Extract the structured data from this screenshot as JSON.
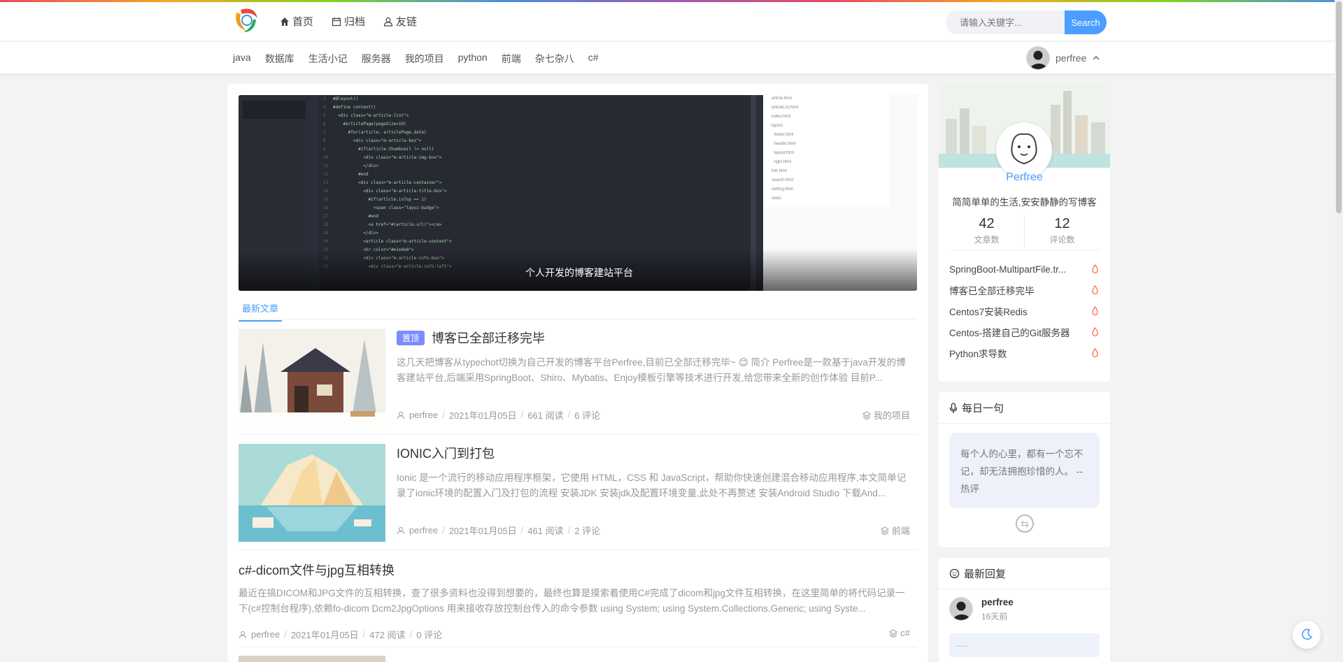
{
  "nav": {
    "items": [
      {
        "label": "首页",
        "icon": "home-icon"
      },
      {
        "label": "归档",
        "icon": "calendar-icon"
      },
      {
        "label": "友链",
        "icon": "user-icon"
      }
    ]
  },
  "search": {
    "placeholder": "请输入关键字...",
    "button": "Search"
  },
  "categories": [
    "java",
    "数据库",
    "生活小记",
    "服务器",
    "我的项目",
    "python",
    "前端",
    "杂七杂八",
    "c#"
  ],
  "user": {
    "name": "perfree"
  },
  "banner": {
    "caption": "个人开发的博客建站平台"
  },
  "tabs": {
    "latest": "最新文章"
  },
  "articles": [
    {
      "top_tag": "置顶",
      "title": "博客已全部迁移完毕",
      "summary": "这几天把博客从typechot切换为自己开发的博客平台Perfree,目前已全部迁移完毕~ 😊 简介 Perfree是一款基于java开发的博客建站平台,后端采用SpringBoot、Shiro、Mybatis、Enjoy模板引擎等技术进行开发,给您带来全新的创作体验 目前P...",
      "author": "perfree",
      "date": "2021年01月05日",
      "views": "661 阅读",
      "comments": "6 评论",
      "category": "我的项目"
    },
    {
      "title": "IONIC入门到打包",
      "summary": "Ionic 是一个流行的移动应用程序框架，它使用 HTML，CSS 和 JavaScript，帮助你快速创建混合移动应用程序,本文简单记录了ionic环境的配置入门及打包的流程 安装JDK 安装jdk及配置环境变量,此处不再赘述 安装Android Studio 下载And...",
      "author": "perfree",
      "date": "2021年01月05日",
      "views": "461 阅读",
      "comments": "2 评论",
      "category": "前端"
    },
    {
      "title": "c#-dicom文件与jpg互相转换",
      "summary": "最近在搞DICOM和JPG文件的互相转换，查了很多资料也没得到想要的，最终也算是摸索着使用C#完成了dicom和jpg文件互相转换，在这里简单的将代码记录一下(c#控制台程序),依赖fo-dicom Dcm2JpgOptions 用来接收存放控制台传入的命令参数 using System; using System.Collections.Generic; using Syste...",
      "author": "perfree",
      "date": "2021年01月05日",
      "views": "472 阅读",
      "comments": "0 评论",
      "category": "c#"
    }
  ],
  "profile": {
    "name": "Perfree",
    "motto": "简简单单的生活,安安静静的写博客",
    "articles_count": "42",
    "articles_label": "文章数",
    "comments_count": "12",
    "comments_label": "评论数",
    "hot": [
      "SpringBoot-MultipartFile.tr...",
      "博客已全部迁移完毕",
      "Centos7安装Redis",
      "Centos-搭建自己的Git服务器",
      "Python求导数"
    ]
  },
  "daily": {
    "title": "每日一句",
    "quote": "每个人的心里，都有一个忘不记，却无法拥抱珍惜的人。 -- 热评"
  },
  "reply": {
    "title": "最新回复",
    "name": "perfree",
    "time": "16天前",
    "content": "....."
  },
  "colors": {
    "accent": "#4a9eff",
    "top_tag": "#7b8cff",
    "hot_icon": "#ff6b4a"
  }
}
